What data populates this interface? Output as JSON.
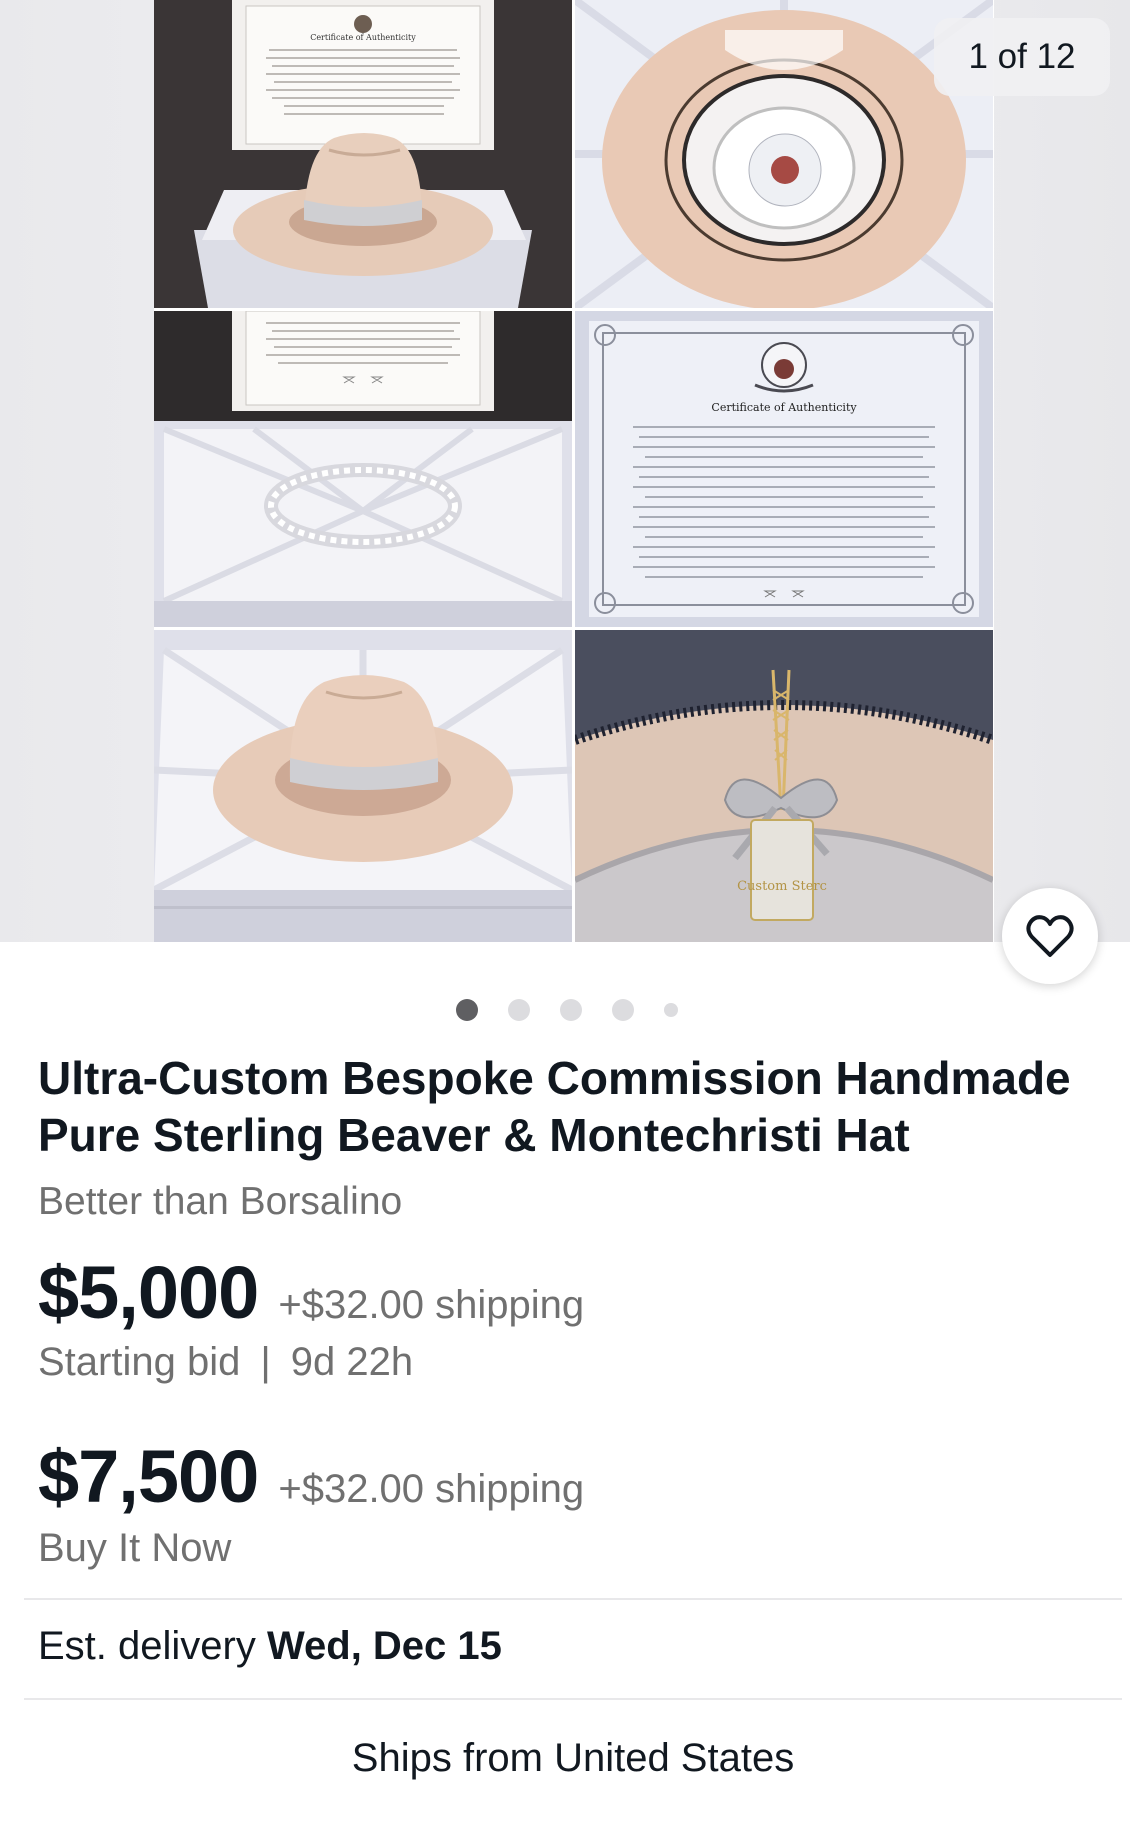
{
  "gallery": {
    "counter": "1 of 12",
    "active_index": 0,
    "dot_count": 5,
    "watch_icon": "heart-outline-icon",
    "certificate_heading": "Certificate of Authenticity",
    "tag_text": "Custom Sterc"
  },
  "listing": {
    "title": "Ultra-Custom Bespoke Commission Handmade Pure Sterling Beaver & Montechristi Hat",
    "subtitle": "Better than Borsalino",
    "auction": {
      "price": "$5,000",
      "shipping": "+$32.00 shipping",
      "label": "Starting bid",
      "separator": "|",
      "time_left": "9d 22h"
    },
    "buy_now": {
      "price": "$7,500",
      "shipping": "+$32.00 shipping",
      "label": "Buy It Now"
    },
    "delivery": {
      "label": "Est. delivery",
      "date": "Wed, Dec 15"
    },
    "ships_from": "Ships from United States"
  },
  "colors": {
    "text_primary": "#111820",
    "text_secondary": "#707070",
    "dot_active": "#5f5f62",
    "dot_inactive": "#dcdcdf",
    "hat_felt": "#e6cbb8",
    "hat_band": "#c9c9cc"
  }
}
